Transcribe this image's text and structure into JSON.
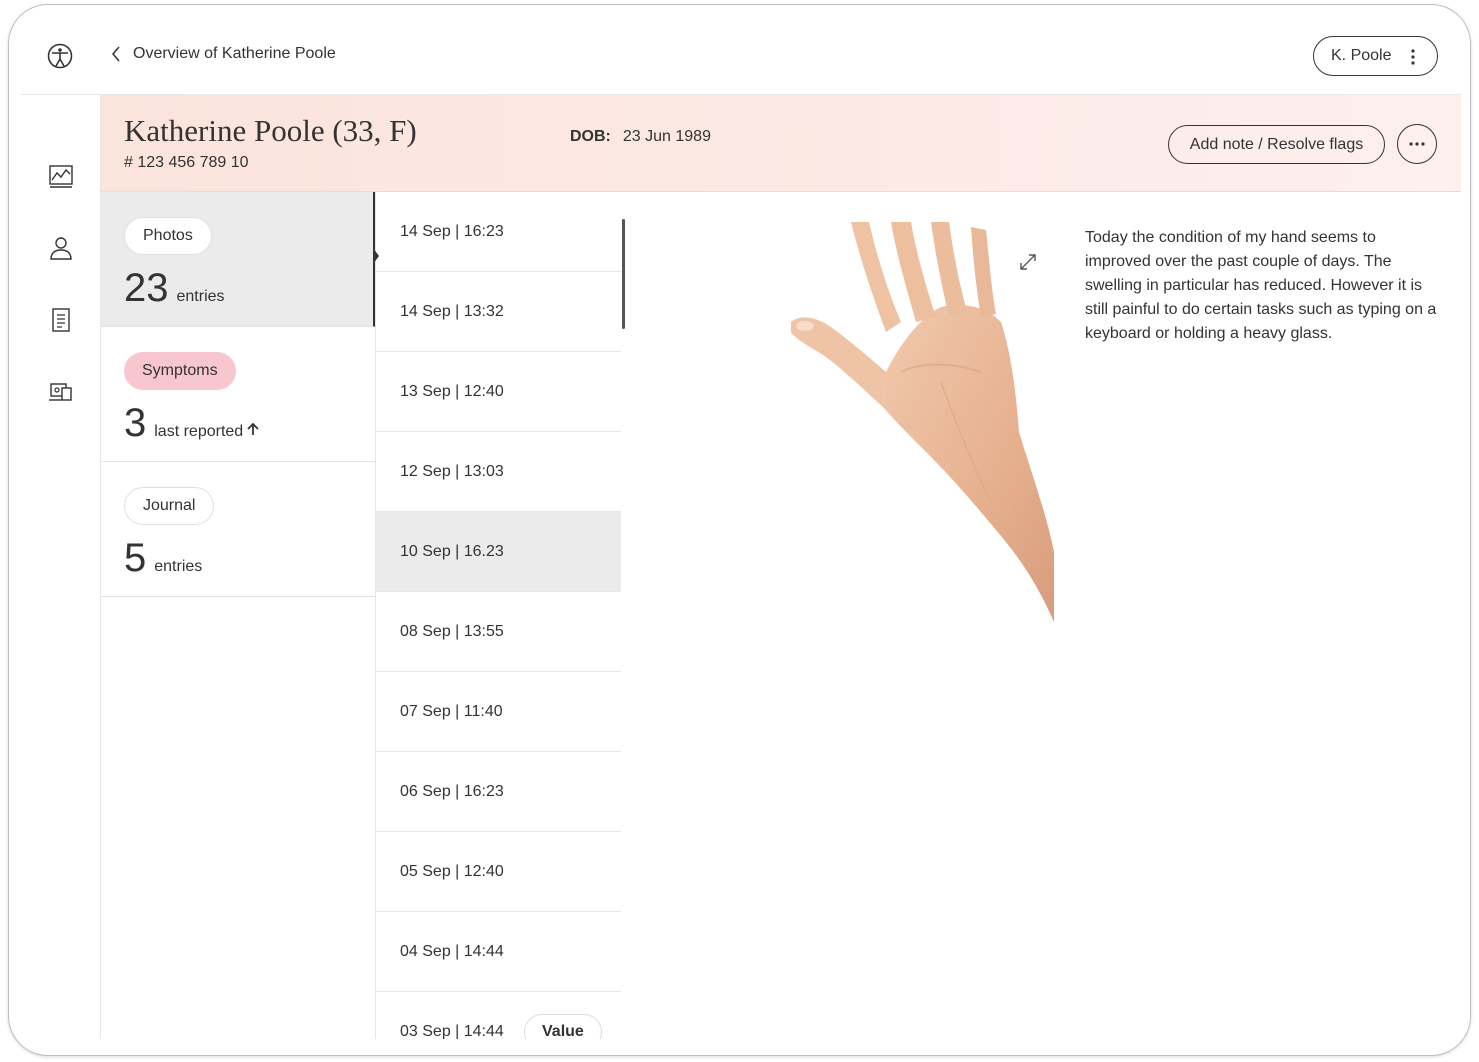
{
  "header": {
    "back_label": "Overview of Katherine Poole",
    "user_button": "K. Poole"
  },
  "patient": {
    "name": "Katherine Poole (33, F)",
    "id": "# 123 456 789 10",
    "dob_label": "DOB:",
    "dob_value": "23 Jun 1989",
    "add_note_label": "Add note / Resolve flags"
  },
  "categories": [
    {
      "label": "Photos",
      "count": "23",
      "suffix": "entries"
    },
    {
      "label": "Symptoms",
      "count": "3",
      "suffix": "last reported"
    },
    {
      "label": "Journal",
      "count": "5",
      "suffix": "entries"
    }
  ],
  "dates": [
    "14 Sep | 16:23",
    "14 Sep | 13:32",
    "13 Sep | 12:40",
    "12 Sep | 13:03",
    "10 Sep | 16.23",
    "08 Sep | 13:55",
    "07 Sep | 11:40",
    "06 Sep | 16:23",
    "05 Sep | 12:40",
    "04 Sep | 14:44",
    "03 Sep | 14:44"
  ],
  "value_button": "Value",
  "detail": {
    "note": "Today the condition of my hand seems to improved over the past couple of days. The swelling in particular has reduced. However it is still painful to do certain tasks such as typing on a keyboard or holding a heavy glass."
  },
  "icons": {
    "logo": "accessibility-logo-icon",
    "nav": [
      "chart-icon",
      "user-icon",
      "document-icon",
      "devices-icon"
    ]
  }
}
